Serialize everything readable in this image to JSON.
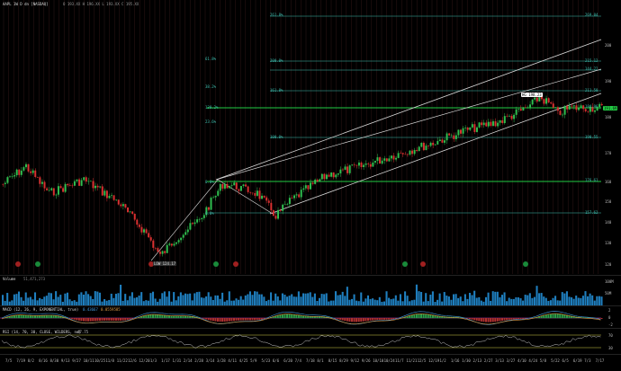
{
  "header": {
    "symbol_line": "AAPL 1W D dn [NASDAQ]",
    "ohlc_line": "O 193.XX H 196.XX L 193.XX C 195.XX"
  },
  "colors": {
    "background": "#000000",
    "fib_line": "#3fbfb0",
    "channel_line": "#d9d9d9",
    "up_candle": "#2fbf4f",
    "down_candle": "#d93030",
    "green_level": "#22cc44",
    "vline": "#5a2a2a"
  },
  "price_panel": {
    "fib_labels_left": [
      "261.8%",
      "200.0%",
      "161.8%",
      "138.2%",
      "100.0%",
      "61.8%",
      "38.2%",
      "23.6%",
      "0.0%",
      "6.0%"
    ],
    "fib_labels_right": [
      "269.04",
      "215.12",
      "211.58",
      "190.55",
      "176.61",
      "157.62",
      "144.22",
      "184.96"
    ],
    "axis_labels": [
      "200",
      "190",
      "180",
      "170",
      "160",
      "150",
      "140",
      "130",
      "120"
    ],
    "high_callout": "HG 198.23",
    "low_callout": "LOW 124.17",
    "last_price": "191.69",
    "pivot_badges": [
      "H",
      "L",
      "H",
      "L",
      "H",
      "L",
      "H",
      "L",
      "H",
      "L",
      "H",
      "L",
      "H"
    ]
  },
  "volume_panel": {
    "label": "Volume",
    "value": "51,471,273",
    "axis_labels": [
      "100M",
      "50M"
    ]
  },
  "macd_panel": {
    "label": "MACD (12, 26, 9, EXPONENTIAL, true)",
    "value1": "0.43667",
    "value2": "0.0559585",
    "axis_labels": [
      "2",
      "0",
      "-2"
    ]
  },
  "rsi_panel": {
    "label": "RSI (14, 70, 30, CLOSE, WILDERS, no)",
    "value": "47.75",
    "axis_labels": [
      "70",
      "30"
    ]
  },
  "x_axis": {
    "labels": [
      "7/5",
      "7/19",
      "8/2",
      "8/16",
      "8/30",
      "9/13",
      "9/27",
      "10/11",
      "10/25",
      "11/8",
      "11/22",
      "12/6",
      "12/20",
      "1/3",
      "1/17",
      "1/31",
      "2/14",
      "2/28",
      "3/14",
      "3/28",
      "4/11",
      "4/25",
      "5/9",
      "5/23",
      "6/6",
      "6/20",
      "7/4",
      "7/18",
      "8/1",
      "8/15",
      "8/29",
      "9/12",
      "9/26",
      "10/10",
      "10/24",
      "11/7",
      "11/21",
      "12/5",
      "12/19",
      "1/2",
      "1/16",
      "1/30",
      "2/13",
      "2/27",
      "3/13",
      "3/27",
      "4/10",
      "4/24",
      "5/8",
      "5/22",
      "6/5",
      "6/19",
      "7/3",
      "7/17"
    ]
  }
}
